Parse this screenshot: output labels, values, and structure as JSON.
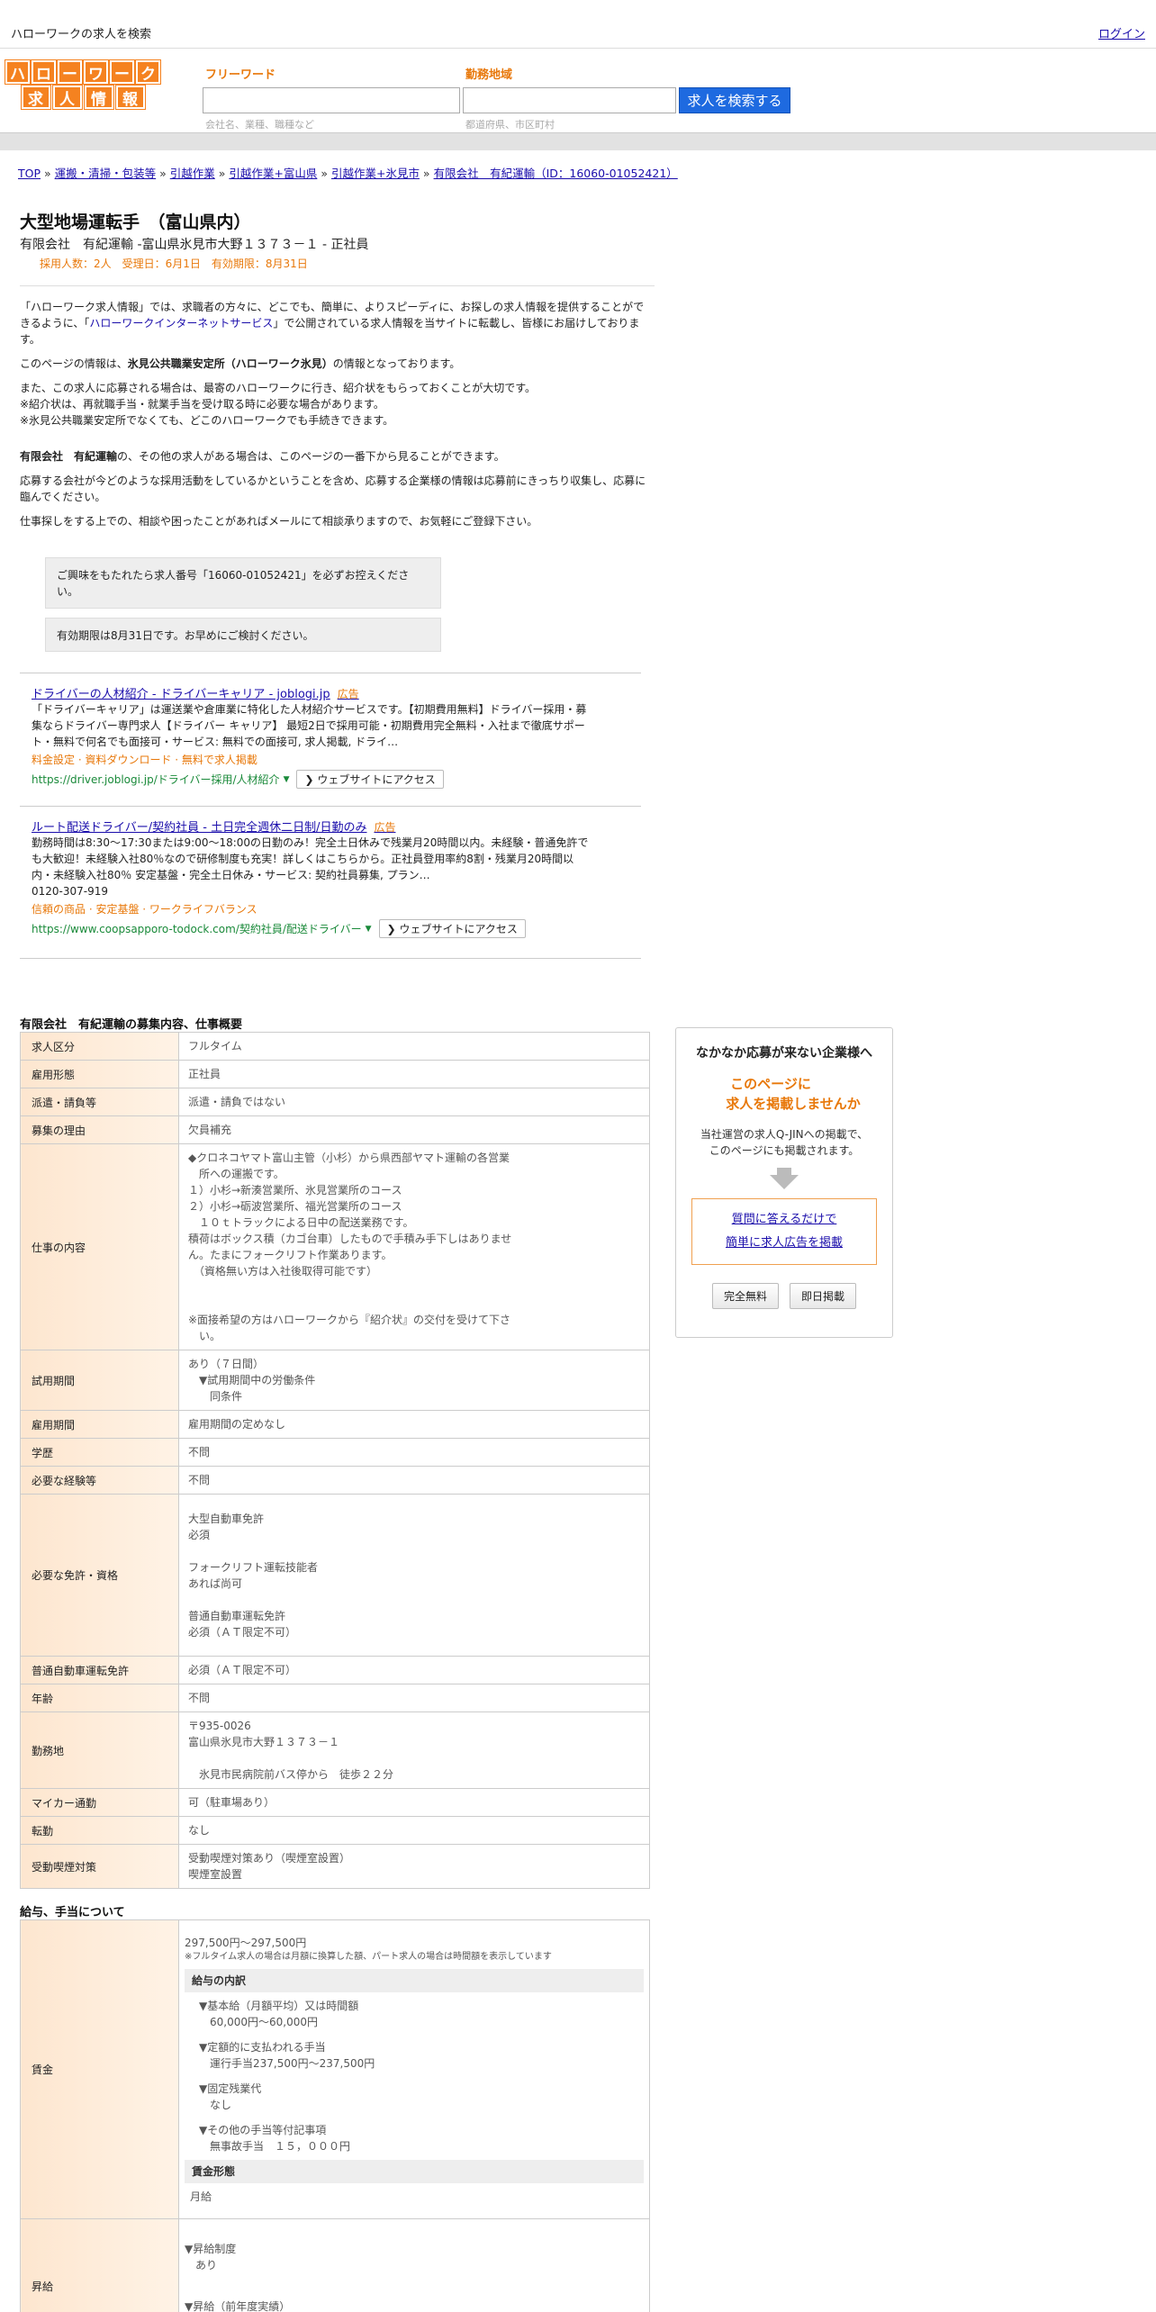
{
  "topbar": {
    "site": "ハローワークの求人を検索",
    "login": "ログイン"
  },
  "logo": {
    "row1": [
      "ハ",
      "ロ",
      "ー",
      "ワ",
      "ー",
      "ク"
    ],
    "row2": [
      "求",
      "人",
      "情",
      "報"
    ]
  },
  "search": {
    "freeword_label": "フリーワード",
    "freeword_ph": "会社名、業種、職種など",
    "area_label": "勤務地域",
    "area_ph": "都道府県、市区町村",
    "button": "求人を検索する"
  },
  "crumbs": [
    "TOP",
    "運搬・清掃・包装等",
    "引越作業",
    "引越作業+富山県",
    "引越作業+氷見市",
    "有限会社　有紀運輸（ID：16060-01052421）"
  ],
  "job": {
    "title": "大型地場運転手　（富山県内）",
    "company": "有限会社　有紀運輸 -富山県氷見市大野１３７３－１ - 正社員",
    "meta": "採用人数：2人　受理日：6月1日　有効期限：8月31日"
  },
  "intro": {
    "p1a": "「ハローワーク求人情報」では、求職者の方々に、どこでも、簡単に、よりスピーディに、お探しの求人情報を提供することができるように、「",
    "p1link": "ハローワークインターネットサービス",
    "p1b": "」で公開されている求人情報を当サイトに転載し、皆様にお届けしております。",
    "p2a": "このページの情報は、",
    "p2b": "氷見公共職業安定所（ハローワーク氷見）",
    "p2c": "の情報となっております。",
    "p3": "また、この求人に応募される場合は、最寄のハローワークに行き、紹介状をもらっておくことが大切です。",
    "p4": "※紹介状は、再就職手当・就業手当を受け取る時に必要な場合があります。",
    "p5": "※氷見公共職業安定所でなくても、どこのハローワークでも手続きできます。",
    "p6a": "有限会社　有紀運輸",
    "p6b": "の、その他の求人がある場合は、このページの一番下から見ることができます。",
    "p7": "応募する会社が今どのような採用活動をしているかということを含め、応募する企業様の情報は応募前にきっちり収集し、応募に臨んでください。",
    "p8": "仕事探しをする上での、相談や困ったことがあればメールにて相談承りますので、お気軽にご登録下さい。"
  },
  "boxes": {
    "b1": "ご興味をもたれたら求人番号「16060-01052421」を必ずお控えください。",
    "b2": "有効期限は8月31日です。お早めにご検討ください。"
  },
  "ads": [
    {
      "title": "ドライバーの人材紹介 - ドライバーキャリア - joblogi.jp",
      "tag": "広告",
      "desc": "「ドライバーキャリア」は運送業や倉庫業に特化した人材紹介サービスです。【初期費用無料】ドライバー採用・募集ならドライバー専門求人【ドライバー キャリア】 最短2日で採用可能・初期費用完全無料・入社まで徹底サポート・無料で何名でも面接可・サービス: 無料での面接可, 求人掲載, ドライ…",
      "sub": "料金設定 · 資料ダウンロード · 無料で求人掲載",
      "url": "https://driver.joblogi.jp/ドライバー採用/人材紹介",
      "btn": "ウェブサイトにアクセス"
    },
    {
      "title": "ルート配送ドライバー/契約社員 - 土日完全週休二日制/日勤のみ",
      "tag": "広告",
      "desc": "勤務時間は8:30～17:30または9:00～18:00の日勤のみ！完全土日休みで残業月20時間以内。未経験・普通免許でも大歓迎！未経験入社80％なので研修制度も充実！詳しくはこちらから。正社員登用率約8割・残業月20時間以内・未経験入社80％ 安定基盤・完全土日休み・サービス: 契約社員募集, プラン…",
      "phone": "0120-307-919",
      "sub": "信頼の商品 · 安定基盤 · ワークライフバランス",
      "url": "https://www.coopsapporo-todock.com/契約社員/配送ドライバー",
      "btn": "ウェブサイトにアクセス"
    }
  ],
  "sect1": "有限会社　有紀運輸の募集内容、仕事概要",
  "rows": [
    {
      "k": "求人区分",
      "v": "フルタイム"
    },
    {
      "k": "雇用形態",
      "v": "正社員"
    },
    {
      "k": "派遣・請負等",
      "v": "派遣・請負ではない"
    },
    {
      "k": "募集の理由",
      "v": "欠員補充"
    },
    {
      "k": "仕事の内容",
      "v": "◆クロネコヤマト富山主管（小杉）から県西部ヤマト運輸の各営業\n　所への運搬です。\n１）小杉→新湊営業所、氷見営業所のコース\n２）小杉→砺波営業所、福光営業所のコース\n　１０ｔトラックによる日中の配送業務です。\n積荷はボックス積（カゴ台車）したもので手積み手下しはありませ\nん。たまにフォークリフト作業あります。\n　（資格無い方は入社後取得可能です）\n\n\n※面接希望の方はハローワークから『紹介状』の交付を受けて下さ\n　い。"
    },
    {
      "k": "試用期間",
      "v": "あり（７日間）\n　▼試用期間中の労働条件\n　　同条件"
    },
    {
      "k": "雇用期間",
      "v": "雇用期間の定めなし"
    },
    {
      "k": "学歴",
      "v": "不問"
    },
    {
      "k": "必要な経験等",
      "v": "不問"
    },
    {
      "k": "必要な免許・資格",
      "v": "大型自動車免許\n必須\n\nフォークリフト運転技能者\nあれば尚可\n\n普通自動車運転免許\n必須（ＡＴ限定不可）"
    },
    {
      "k": "普通自動車運転免許",
      "v": "必須（ＡＴ限定不可）"
    },
    {
      "k": "年齢",
      "v": "不問"
    },
    {
      "k": "勤務地",
      "v": "〒935-0026\n富山県氷見市大野１３７３－１\n\n　氷見市民病院前バス停から　徒歩２２分"
    },
    {
      "k": "マイカー通勤",
      "v": "可（駐車場あり）"
    },
    {
      "k": "転勤",
      "v": "なし"
    },
    {
      "k": "受動喫煙対策",
      "v": "受動喫煙対策あり（喫煙室設置）\n喫煙室設置"
    }
  ],
  "sect2": "給与、手当について",
  "wage": {
    "k": "賃金",
    "range": "297,500円〜297,500円",
    "note": "※フルタイム求人の場合は月額に換算した額、パート求人の場合は時間額を表示しています",
    "h1": "給与の内訳",
    "i1": "▼基本給（月額平均）又は時間額\n　60,000円〜60,000円",
    "i2": "▼定額的に支払われる手当\n　運行手当237,500円〜237,500円",
    "i3": "▼固定残業代\n　なし",
    "i4": "▼その他の手当等付記事項\n　無事故手当　１５，０００円",
    "h2": "賃金形態",
    "i5": "月給"
  },
  "raise": {
    "k": "昇給",
    "i1": "▼昇給制度\n　あり",
    "i2": "▼昇給（前年度実績）\n　あり"
  },
  "side": {
    "h": "なかなか応募が来ない企業様へ",
    "o1": "このページに",
    "o2": "求人を掲載しませんか",
    "g1": "当社運営の求人Q-JINへの掲載で、",
    "g2": "このページにも掲載されます。",
    "l1": "質問に答えるだけで",
    "l2": "簡単に求人広告を掲載",
    "b1": "完全無料",
    "b2": "即日掲載"
  }
}
